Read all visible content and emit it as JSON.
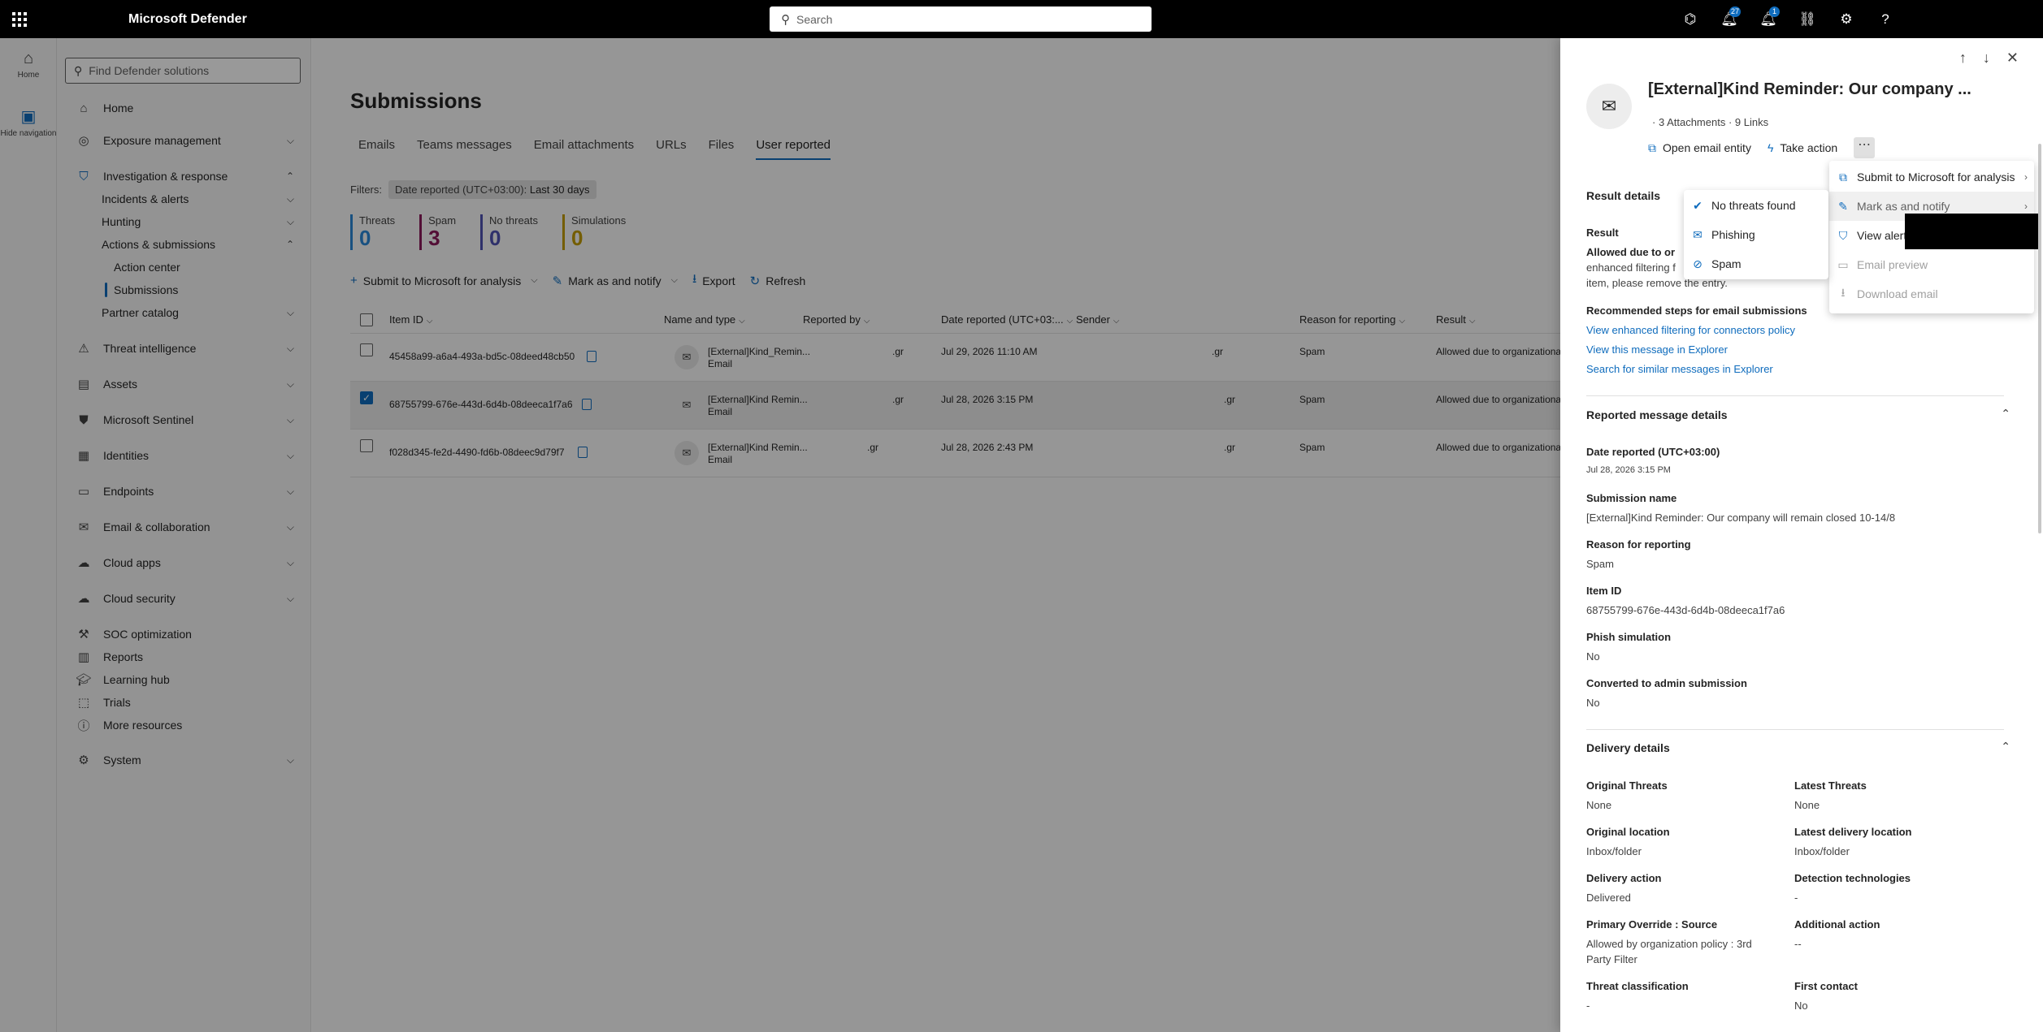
{
  "topbar": {
    "app_title": "Microsoft Defender",
    "search_placeholder": "Search",
    "badges": {
      "notifications_a": "27",
      "notifications_b": "1"
    }
  },
  "rail": {
    "home": "Home",
    "hide": "Hide navigation"
  },
  "sidenav": {
    "find_placeholder": "Find Defender solutions",
    "items": {
      "home": "Home",
      "exposure": "Exposure management",
      "investigation": "Investigation & response",
      "incidents": "Incidents & alerts",
      "hunting": "Hunting",
      "actions": "Actions & submissions",
      "action_center": "Action center",
      "submissions": "Submissions",
      "partner": "Partner catalog",
      "threat_intel": "Threat intelligence",
      "assets": "Assets",
      "sentinel": "Microsoft Sentinel",
      "identities": "Identities",
      "endpoints": "Endpoints",
      "email": "Email & collaboration",
      "cloud_apps": "Cloud apps",
      "cloud_security": "Cloud security",
      "soc": "SOC optimization",
      "reports": "Reports",
      "learning": "Learning hub",
      "trials": "Trials",
      "more": "More resources",
      "system": "System"
    }
  },
  "main": {
    "title": "Submissions",
    "tabs": [
      "Emails",
      "Teams messages",
      "Email attachments",
      "URLs",
      "Files",
      "User reported"
    ],
    "filters_label": "Filters:",
    "filter_chip_key": "Date reported (UTC+03:00):",
    "filter_chip_value": "Last 30 days",
    "counters": [
      {
        "label": "Threats",
        "value": "0",
        "color": "#2b88d8"
      },
      {
        "label": "Spam",
        "value": "3",
        "color": "#8b1a5a"
      },
      {
        "label": "No threats",
        "value": "0",
        "color": "#4f52b2"
      },
      {
        "label": "Simulations",
        "value": "0",
        "color": "#c19c00"
      }
    ],
    "toolbar": {
      "submit": "Submit to Microsoft for analysis",
      "mark": "Mark as and notify",
      "export": "Export",
      "refresh": "Refresh"
    },
    "columns": {
      "item_id": "Item ID",
      "name": "Name and type",
      "reported_by": "Reported by",
      "date": "Date reported (UTC+03:...",
      "sender": "Sender",
      "reason": "Reason for reporting",
      "result": "Result"
    },
    "rows": [
      {
        "id": "45458a99-a6a4-493a-bd5c-08deed48cb50",
        "name": "[External]Kind_Remin...",
        "type": "Email",
        "reported_by": ".gr",
        "date": "Jul 29, 2026 11:10 AM",
        "sender": ".gr",
        "reason": "Spam",
        "result": "Allowed due to organizational",
        "checked": false
      },
      {
        "id": "68755799-676e-443d-6d4b-08deeca1f7a6",
        "name": "[External]Kind Remin...",
        "type": "Email",
        "reported_by": ".gr",
        "date": "Jul 28, 2026 3:15 PM",
        "sender": ".gr",
        "reason": "Spam",
        "result": "Allowed due to organizational",
        "checked": true
      },
      {
        "id": "f028d345-fe2d-4490-fd6b-08deec9d79f7",
        "name": "[External]Kind Remin...",
        "type": "Email",
        "reported_by": ".gr",
        "date": "Jul 28, 2026 2:43 PM",
        "sender": ".gr",
        "reason": "Spam",
        "result": "Allowed due to organizational",
        "checked": false
      }
    ]
  },
  "panel": {
    "title": "[External]Kind Reminder: Our company ...",
    "attachments": "3 Attachments",
    "links": "9 Links",
    "open_entity": "Open email entity",
    "take_action": "Take action",
    "more": "⋯",
    "result_details": "Result details",
    "result_label": "Result",
    "result_bold": "Allowed due to or",
    "result_line2": "enhanced filtering f",
    "result_line3": "item, please remove the entry.",
    "recommended": "Recommended steps for email submissions",
    "link1": "View enhanced filtering for connectors policy",
    "link2": "View this message in Explorer",
    "link3": "Search for similar messages in Explorer",
    "reported_details": "Reported message details",
    "date_label": "Date reported (UTC+03:00)",
    "date_value": "Jul 28, 2026 3:15 PM",
    "subname_label": "Submission name",
    "subname_value": "[External]Kind Reminder: Our company will remain closed 10-14/8",
    "reason_label": "Reason for reporting",
    "reason_value": "Spam",
    "itemid_label": "Item ID",
    "itemid_value": "68755799-676e-443d-6d4b-08deeca1f7a6",
    "phish_label": "Phish simulation",
    "phish_value": "No",
    "converted_label": "Converted to admin submission",
    "converted_value": "No",
    "delivery_details": "Delivery details",
    "orig_threats_label": "Original Threats",
    "orig_threats_value": "None",
    "latest_threats_label": "Latest Threats",
    "latest_threats_value": "None",
    "orig_loc_label": "Original location",
    "orig_loc_value": "Inbox/folder",
    "latest_loc_label": "Latest delivery location",
    "latest_loc_value": "Inbox/folder",
    "delivery_action_label": "Delivery action",
    "delivery_action_value": "Delivered",
    "detection_label": "Detection technologies",
    "detection_value": "-",
    "override_label": "Primary Override : Source",
    "override_value1": "Allowed by organization policy : 3rd",
    "override_value2": "Party Filter",
    "additional_label": "Additional action",
    "additional_value": "--",
    "threat_class_label": "Threat classification",
    "threat_class_value": "-",
    "first_contact_label": "First contact",
    "first_contact_value": "No"
  },
  "more_menu": {
    "submit": "Submit to Microsoft for analysis",
    "mark": "Mark as and notify",
    "view_alert": "View alert",
    "preview": "Email preview",
    "download": "Download email"
  },
  "mark_submenu": {
    "no_threats": "No threats found",
    "phishing": "Phishing",
    "spam": "Spam"
  }
}
